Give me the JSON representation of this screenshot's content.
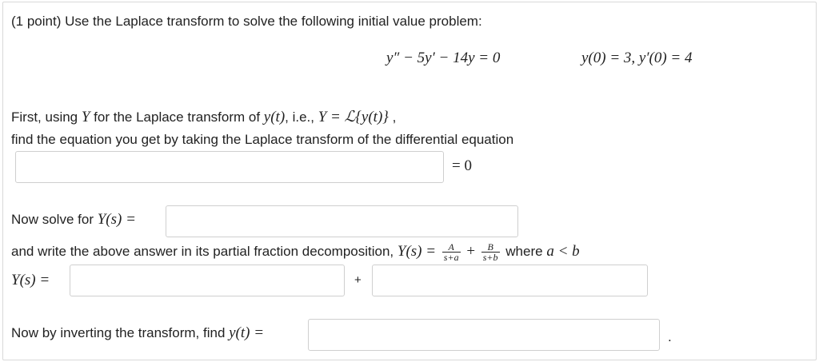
{
  "problem": {
    "header": "(1 point) Use the Laplace transform to solve the following initial value problem:",
    "ode": "y″ − 5y′ − 14y = 0",
    "initial_conditions": "y(0) = 3,  y′(0) = 4"
  },
  "step1": {
    "prefix": "First, using ",
    "var_Y": "Y",
    "mid": " for the Laplace transform of ",
    "yt": "y(t)",
    "ie": ", i.e., ",
    "def": "Y = ℒ{y(t)}",
    "suffix": " ,",
    "line2": "find the equation you get by taking the Laplace transform of the differential equation",
    "equals_zero": "= 0"
  },
  "step2": {
    "label": "Now solve for ",
    "Ys": "Y(s) ="
  },
  "step3": {
    "text": "and write the above answer in its partial fraction decomposition, ",
    "Ys_eq": "Y(s) =",
    "frac1_num": "A",
    "frac1_den": "s+a",
    "plus": "+",
    "frac2_num": "B",
    "frac2_den": "s+b",
    "where": " where ",
    "cond": "a < b",
    "Ys_label": "Y(s) =",
    "plus_between": "+"
  },
  "step4": {
    "text": "Now by inverting the transform, find ",
    "yt_eq": "y(t) =",
    "period": "."
  }
}
